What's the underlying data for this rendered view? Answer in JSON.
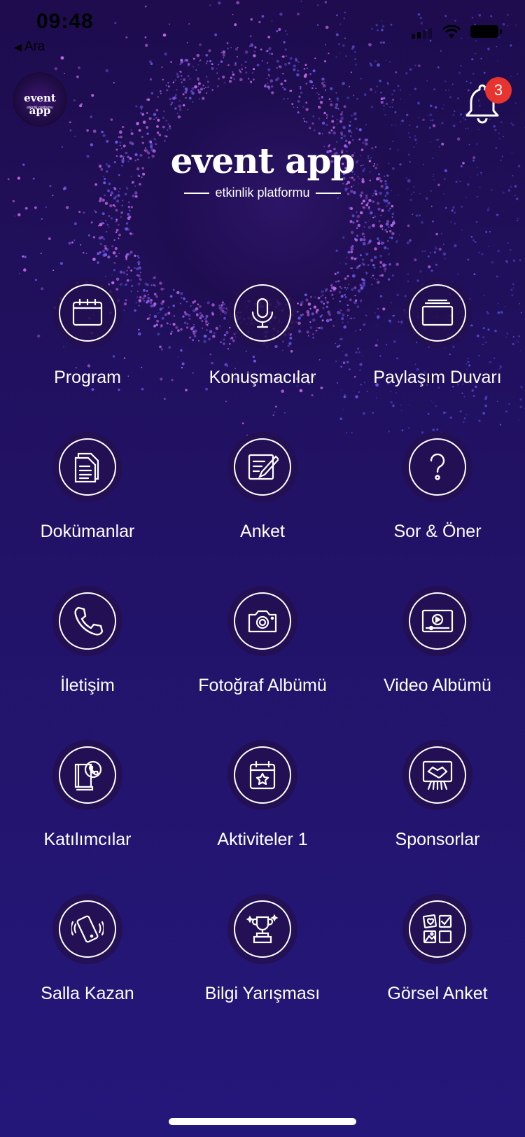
{
  "status_bar": {
    "time": "09:48",
    "back_app": "Ara",
    "back_icon": "back-arrow-icon"
  },
  "header": {
    "logo_text": "event app",
    "logo_subtext": "etkinlik platformu",
    "notification_count": "3"
  },
  "brand": {
    "title": "event app",
    "subtitle": "etkinlik platformu"
  },
  "colors": {
    "background_top": "#1e0c4e",
    "background_bottom": "#24177a",
    "badge": "#e8342e",
    "particles": "#c86be8"
  },
  "menu": [
    {
      "label": "Program",
      "icon": "calendar-icon"
    },
    {
      "label": "Konuşmacılar",
      "icon": "microphone-icon"
    },
    {
      "label": "Paylaşım Duvarı",
      "icon": "board-icon"
    },
    {
      "label": "Dokümanlar",
      "icon": "documents-icon"
    },
    {
      "label": "Anket",
      "icon": "survey-icon"
    },
    {
      "label": "Sor & Öner",
      "icon": "question-icon"
    },
    {
      "label": "İletişim",
      "icon": "phone-icon"
    },
    {
      "label": "Fotoğraf Albümü",
      "icon": "camera-icon"
    },
    {
      "label": "Video Albümü",
      "icon": "video-icon"
    },
    {
      "label": "Katılımcılar",
      "icon": "contacts-book-icon"
    },
    {
      "label": "Aktiviteler 1",
      "icon": "calendar-star-icon"
    },
    {
      "label": "Sponsorlar",
      "icon": "handshake-board-icon"
    },
    {
      "label": "Salla Kazan",
      "icon": "shake-phone-icon"
    },
    {
      "label": "Bilgi Yarışması",
      "icon": "trophy-icon"
    },
    {
      "label": "Görsel Anket",
      "icon": "image-poll-icon"
    }
  ]
}
